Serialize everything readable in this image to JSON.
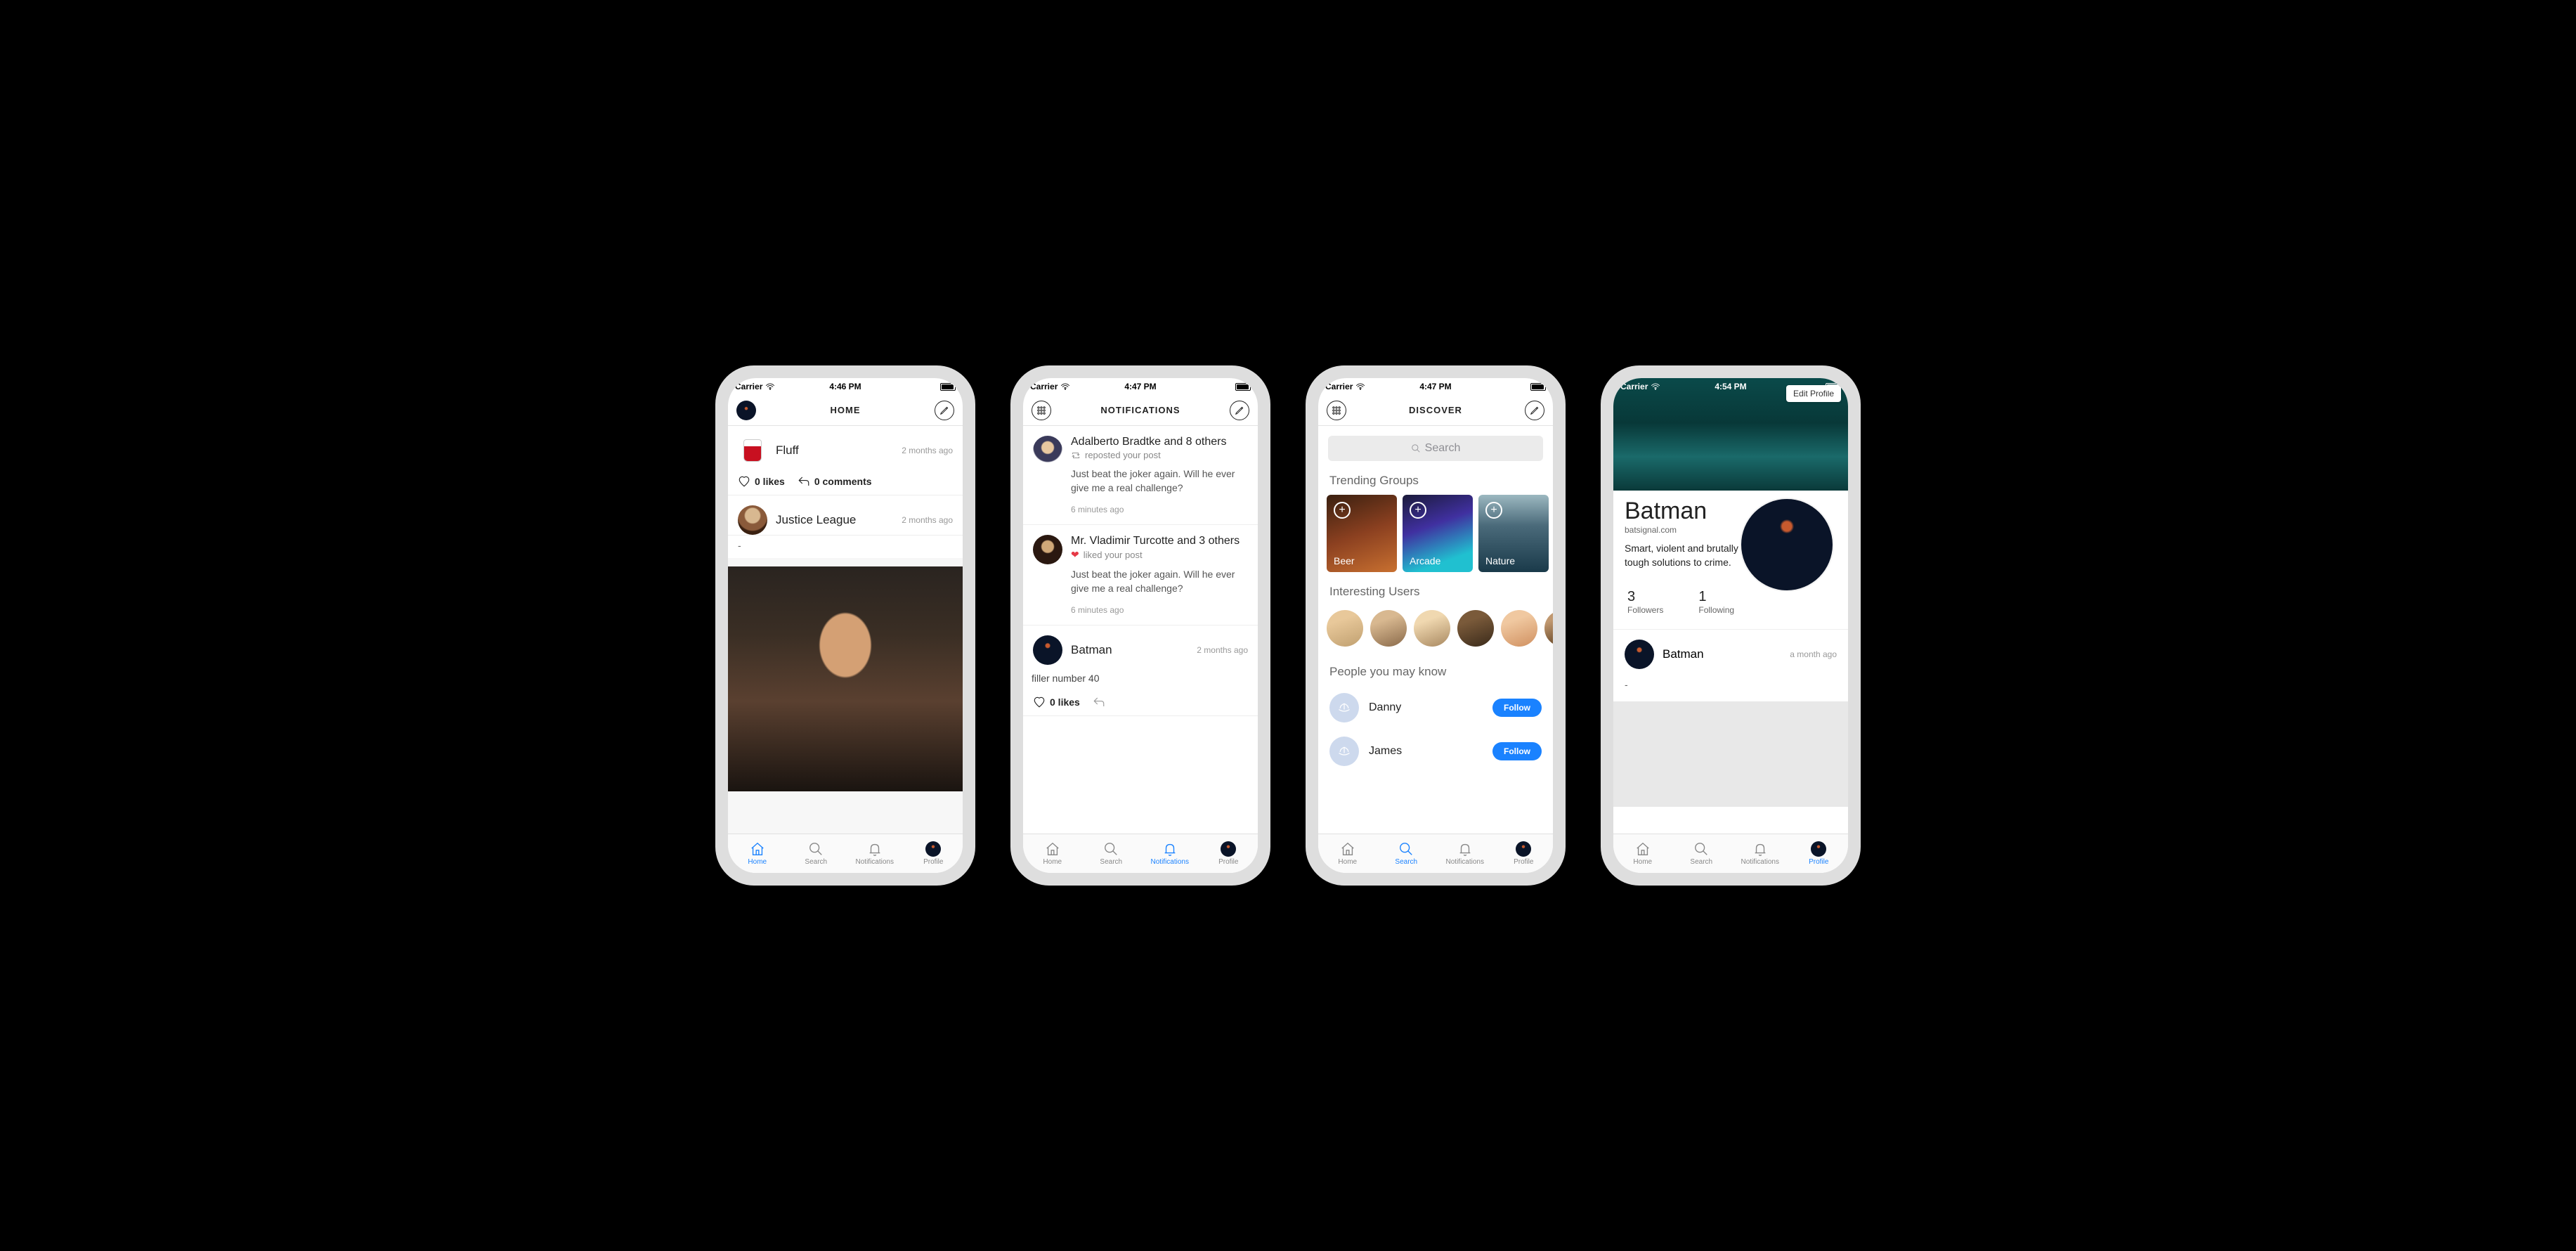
{
  "statusbar": {
    "carrier": "Carrier",
    "times": [
      "4:46 PM",
      "4:47 PM",
      "4:47 PM",
      "4:54 PM"
    ]
  },
  "tabs": {
    "home": "Home",
    "search": "Search",
    "notifications": "Notifications",
    "profile": "Profile"
  },
  "screen1": {
    "title": "HOME",
    "posts": [
      {
        "user": "Fluff",
        "ago": "2 months ago",
        "likes": "0 likes",
        "comments": "0 comments"
      },
      {
        "user": "Justice League",
        "ago": "2 months ago",
        "body": "-"
      }
    ]
  },
  "screen2": {
    "title": "NOTIFICATIONS",
    "items": [
      {
        "title": "Adalberto Bradtke and 8 others",
        "action": "reposted your post",
        "text": "Just beat the joker again. Will he ever give me a real challenge?",
        "ago": "6 minutes ago"
      },
      {
        "title": "Mr. Vladimir Turcotte and 3 others",
        "action": "liked your post",
        "text": "Just beat the joker again. Will he ever give me a real challenge?",
        "ago": "6 minutes ago"
      }
    ],
    "post": {
      "user": "Batman",
      "ago": "2 months ago",
      "body": "filler number 40",
      "likes": "0 likes"
    }
  },
  "screen3": {
    "title": "DISCOVER",
    "search_placeholder": "Search",
    "sections": {
      "trending": "Trending Groups",
      "users": "Interesting Users",
      "suggest": "People you may know"
    },
    "groups": [
      {
        "name": "Beer"
      },
      {
        "name": "Arcade"
      },
      {
        "name": "Nature"
      }
    ],
    "suggestions": [
      {
        "name": "Danny",
        "btn": "Follow"
      },
      {
        "name": "James",
        "btn": "Follow"
      }
    ]
  },
  "screen4": {
    "edit": "Edit Profile",
    "name": "Batman",
    "link": "batsignal.com",
    "bio": "Smart, violent and brutally tough solutions to crime.",
    "stats": {
      "followers_n": "3",
      "followers_l": "Followers",
      "following_n": "1",
      "following_l": "Following"
    },
    "post": {
      "user": "Batman",
      "ago": "a month ago",
      "body": "-"
    }
  }
}
